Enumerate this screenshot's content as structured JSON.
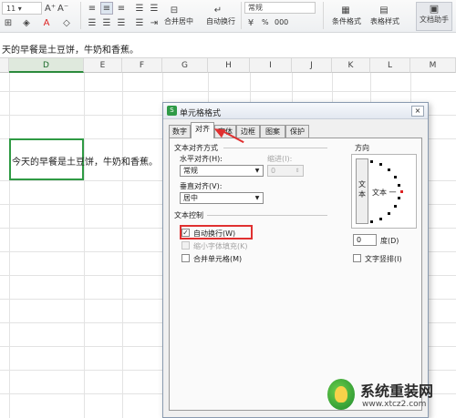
{
  "ribbon": {
    "number_format": "常规",
    "merge_center": "合并居中",
    "auto_wrap": "自动换行",
    "percent": "%",
    "zero_zero": "000",
    "conditional_format": "条件格式",
    "table_style": "表格样式",
    "doc_helper": "文档助手"
  },
  "formula_bar": {
    "content": "天的早餐是土豆饼，牛奶和香蕉。"
  },
  "columns": [
    "D",
    "E",
    "F",
    "G",
    "H",
    "I",
    "J",
    "K",
    "L",
    "M"
  ],
  "cell": {
    "text": "今天的早餐是土豆饼，牛奶和香蕉。"
  },
  "dialog": {
    "title": "单元格格式",
    "close": "×",
    "tabs": [
      "数字",
      "对齐",
      "字体",
      "边框",
      "图案",
      "保护"
    ],
    "active_tab": "对齐",
    "text_alignment": {
      "heading": "文本对齐方式",
      "horizontal_label": "水平对齐(H):",
      "horizontal_value": "常规",
      "indent_label": "缩进(I):",
      "indent_value": "0",
      "vertical_label": "垂直对齐(V):",
      "vertical_value": "居中"
    },
    "text_control": {
      "heading": "文本控制",
      "wrap_label": "自动换行(W)",
      "wrap_checked": true,
      "shrink_label": "缩小字体填充(K)",
      "shrink_checked": false,
      "merge_label": "合并单元格(M)",
      "merge_checked": false
    },
    "orientation": {
      "heading": "方向",
      "vertical_text": "文本",
      "rotated_text": "文本 一",
      "degree_value": "0",
      "degree_unit": "度(D)",
      "vertical_checkbox_label": "文字竖排(I)"
    }
  },
  "watermark": {
    "name": "系统重装网",
    "url": "www.xtcz2.com"
  },
  "colors": {
    "accent": "#2f9a44",
    "highlight": "#e03030"
  }
}
